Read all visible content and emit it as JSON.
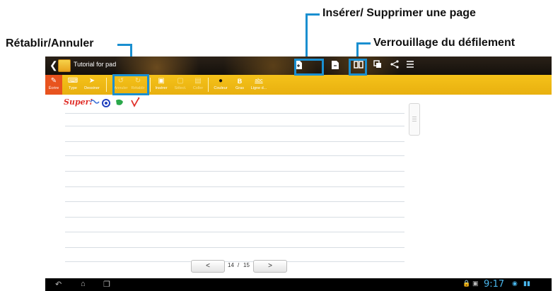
{
  "callouts": {
    "insert_delete_page": "Insérer/ Supprimer une page",
    "scroll_lock": "Verrouillage du défilement",
    "redo_undo": "Rétablir/Annuler"
  },
  "titlebar": {
    "back_icon": "chevron-left-icon",
    "title": "Tutorial for pad",
    "icons": [
      "insert-page-icon",
      "delete-page-icon",
      "scroll-lock-icon",
      "copy-icon",
      "share-icon",
      "menu-icon"
    ]
  },
  "toolbar": {
    "items": [
      {
        "label": "Écrire",
        "icon": "pen-icon"
      },
      {
        "label": "Type",
        "icon": "keyboard-icon"
      },
      {
        "label": "Dessiner",
        "icon": "brush-icon"
      },
      {
        "label": "Annuler",
        "icon": "undo-icon"
      },
      {
        "label": "Rétablir",
        "icon": "redo-icon"
      },
      {
        "label": "Insérer",
        "icon": "insert-icon"
      },
      {
        "label": "Sélect.",
        "icon": "select-icon"
      },
      {
        "label": "Coller",
        "icon": "paste-icon"
      },
      {
        "label": "Couleur",
        "icon": "color-dot-icon"
      },
      {
        "label": "Gras",
        "icon": "bold-icon",
        "glyph": "B"
      },
      {
        "label": "Ligne d...",
        "icon": "underline-icon",
        "glyph": "abc"
      }
    ]
  },
  "page": {
    "handwriting": "Super!",
    "current": "14",
    "separator": "/",
    "total": "15",
    "prev": "<",
    "next": ">"
  },
  "status": {
    "clock": "9:17",
    "nav_icons": [
      "back-nav-icon",
      "home-nav-icon",
      "recent-apps-icon"
    ]
  },
  "colors": {
    "toolbar": "#f1bb14",
    "active_tool": "#e8531e",
    "callout": "#1a8fd0",
    "handwriting": "#e0302a"
  }
}
